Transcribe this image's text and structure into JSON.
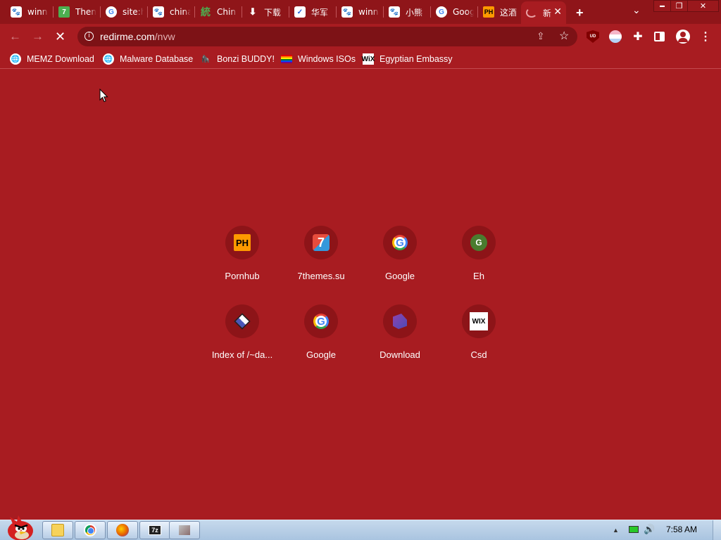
{
  "tabs": [
    {
      "title": "winn",
      "icon": "baidu-icon",
      "glyph": "🐾"
    },
    {
      "title": "Then",
      "icon": "seven-themes-icon",
      "glyph": "7"
    },
    {
      "title": "site:h",
      "icon": "google-icon",
      "glyph": "G"
    },
    {
      "title": "china",
      "icon": "baidu-icon",
      "glyph": "🐾"
    },
    {
      "title": "Chin",
      "icon": "china-icon",
      "glyph": "統"
    },
    {
      "title": "下载",
      "icon": "download-icon",
      "glyph": "⬇"
    },
    {
      "title": "华军",
      "icon": "huajun-icon",
      "glyph": "✓"
    },
    {
      "title": "winn",
      "icon": "baidu-icon",
      "glyph": "🐾"
    },
    {
      "title": "小熊",
      "icon": "baidu-icon",
      "glyph": "🐾"
    },
    {
      "title": "Goog",
      "icon": "google-icon",
      "glyph": "G"
    },
    {
      "title": "这酒",
      "icon": "pornhub-icon",
      "glyph": "PH"
    },
    {
      "title": "新",
      "icon": "loading-spinner-icon",
      "glyph": ""
    }
  ],
  "toolbar": {
    "url_host": "redirme.com",
    "url_path": "/nvw",
    "back_glyph": "←",
    "forward_glyph": "→",
    "stop_glyph": "✕",
    "newtab_glyph": "+",
    "tabsearch_glyph": "⌄",
    "share_glyph": "⇪",
    "star_glyph": "☆",
    "ublock_label": "UD",
    "puzzle_glyph": "✚",
    "menu_glyph": "⋮",
    "info_glyph": "i"
  },
  "window_controls": {
    "minimize": "▬",
    "restore": "❐",
    "close": "✕"
  },
  "bookmarks": [
    {
      "label": "MEMZ Download",
      "icon": "globe-icon",
      "glyph": "🌐"
    },
    {
      "label": "Malware Database",
      "icon": "globe-icon",
      "glyph": "🌐"
    },
    {
      "label": "Bonzi BUDDY!",
      "icon": "bonzi-icon",
      "glyph": "🦍"
    },
    {
      "label": "Windows ISOs",
      "icon": "rainbow-flag-icon",
      "glyph": ""
    },
    {
      "label": "Egyptian Embassy",
      "icon": "wix-icon",
      "glyph": "WiX"
    }
  ],
  "shortcuts": [
    {
      "label": "Pornhub",
      "icon": "pornhub-icon",
      "glyph": "PH"
    },
    {
      "label": "7themes.su",
      "icon": "seven-themes-icon",
      "glyph": "7"
    },
    {
      "label": "Google",
      "icon": "google-icon",
      "glyph": "G"
    },
    {
      "label": "Eh",
      "icon": "eh-letter-icon",
      "glyph": "G"
    },
    {
      "label": "Index of /~da...",
      "icon": "index-folder-icon",
      "glyph": ""
    },
    {
      "label": "Google",
      "icon": "google-icon",
      "glyph": "G"
    },
    {
      "label": "Download",
      "icon": "download-app-icon",
      "glyph": ""
    },
    {
      "label": "Csd",
      "icon": "wix-icon",
      "glyph": "WIX"
    }
  ],
  "taskbar": {
    "items": [
      {
        "name": "explorer-icon"
      },
      {
        "name": "chrome-icon"
      },
      {
        "name": "firefox-icon"
      },
      {
        "name": "7zip-icon",
        "glyph": "7z"
      },
      {
        "name": "app-icon"
      }
    ],
    "clock": "7:58 AM",
    "tray_arrow": "▲",
    "volume_glyph": "🔊"
  },
  "colors": {
    "theme": "#a81c21",
    "tabstrip": "#8f1519",
    "omnibox": "#7d1216"
  }
}
